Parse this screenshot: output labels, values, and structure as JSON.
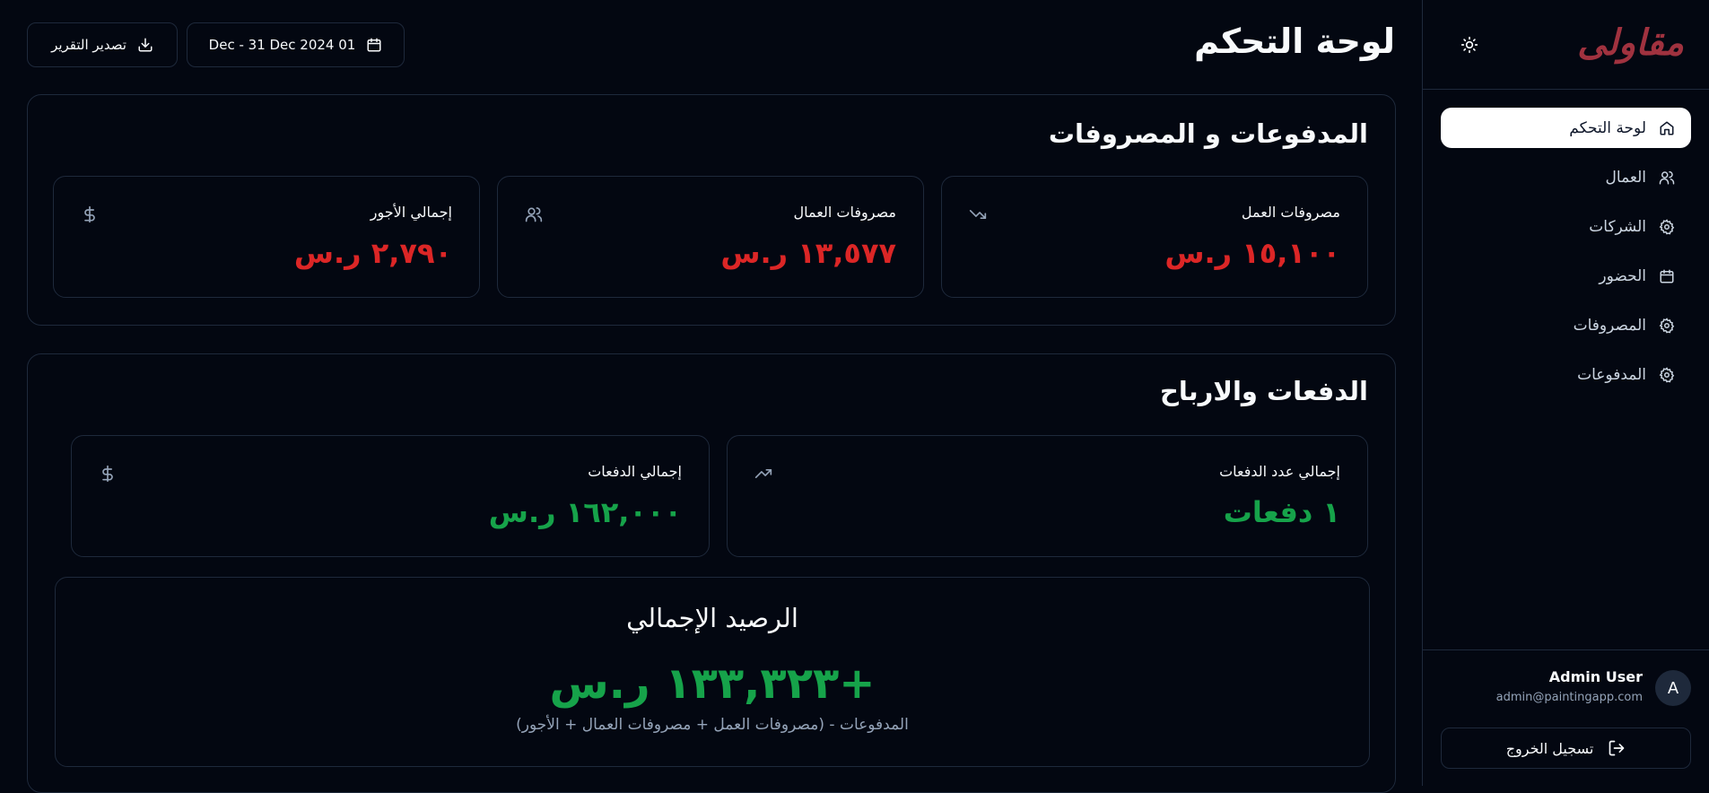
{
  "brand": {
    "logo_text": "مقاولى",
    "accent": "#a0323f"
  },
  "header": {
    "title": "لوحة التحكم",
    "export_label": "تصدير التقرير",
    "date_range": "Dec - 31 Dec 2024 01"
  },
  "sidebar": {
    "items": [
      {
        "label": "لوحة التحكم",
        "icon": "home-icon",
        "active": true
      },
      {
        "label": "العمال",
        "icon": "users-icon",
        "active": false
      },
      {
        "label": "الشركات",
        "icon": "gear-icon",
        "active": false
      },
      {
        "label": "الحضور",
        "icon": "calendar-icon",
        "active": false
      },
      {
        "label": "المصروفات",
        "icon": "gear-icon",
        "active": false
      },
      {
        "label": "المدفوعات",
        "icon": "gear-icon",
        "active": false
      }
    ],
    "user": {
      "initial": "A",
      "name": "Admin User",
      "email": "admin@paintingapp.com"
    },
    "logout_label": "تسجيل الخروج"
  },
  "payments_expenses": {
    "title": "المدفوعات و المصروفات",
    "cards": [
      {
        "label": "مصروفات العمل",
        "value": "١٥,١٠٠ ر.س",
        "icon": "trending-down-icon"
      },
      {
        "label": "مصروفات العمال",
        "value": "١٣,٥٧٧ ر.س",
        "icon": "users-icon"
      },
      {
        "label": "إجمالي الأجور",
        "value": "٢,٧٩٠ ر.س",
        "icon": "dollar-icon"
      }
    ]
  },
  "payments_profits": {
    "title": "الدفعات والارباح",
    "cards": [
      {
        "label": "إجمالي عدد الدفعات",
        "value": "١ دفعات",
        "icon": "trending-up-icon"
      },
      {
        "label": "إجمالي الدفعات",
        "value": "١٦٢,٠٠٠ ر.س",
        "icon": "dollar-icon"
      }
    ],
    "balance": {
      "title": "الرصيد الإجمالي",
      "value": "+١٣٣,٣٢٣ ر.س",
      "formula": "المدفوعات - (مصروفات العمل + مصروفات العمال + الأجور)"
    }
  },
  "colors": {
    "negative": "#dc2626",
    "positive": "#16a34a",
    "background": "#030711",
    "border": "#1e293b"
  }
}
